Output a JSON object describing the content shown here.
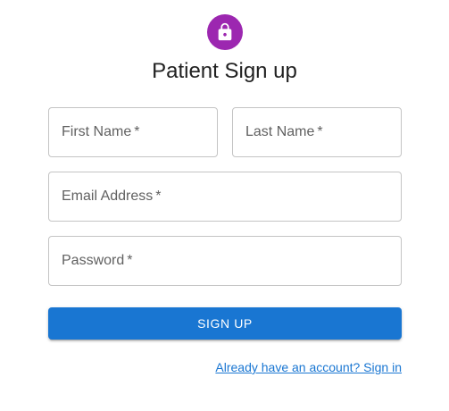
{
  "colors": {
    "avatar_bg": "#9c27b0",
    "primary": "#1976d2",
    "link": "#1976d2"
  },
  "header": {
    "icon": "lock-icon",
    "title": "Patient Sign up"
  },
  "form": {
    "first_name": {
      "label": "First Name",
      "required_mark": "*",
      "value": ""
    },
    "last_name": {
      "label": "Last Name",
      "required_mark": "*",
      "value": ""
    },
    "email": {
      "label": "Email Address",
      "required_mark": "*",
      "value": ""
    },
    "password": {
      "label": "Password",
      "required_mark": "*",
      "value": ""
    },
    "submit_label": "SIGN UP",
    "signin_link": "Already have an account? Sign in"
  }
}
